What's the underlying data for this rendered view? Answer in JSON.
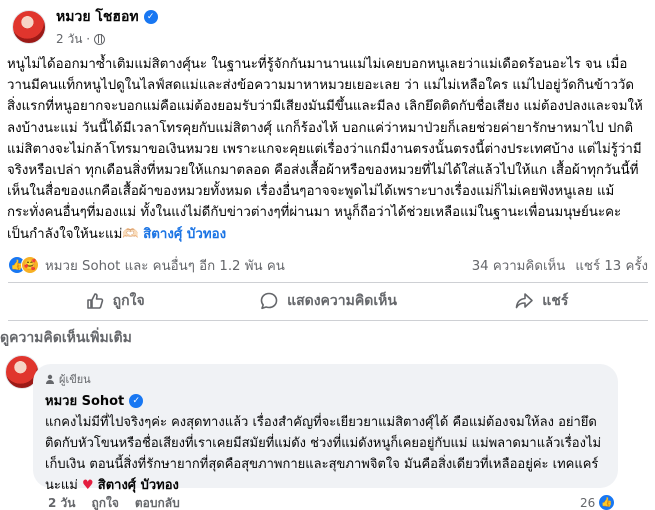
{
  "post": {
    "author": "หมวย โชฮอท",
    "time": "2 วัน ·",
    "body": "หนูไม่ได้ออกมาซ้ำเติมแม่สิตางศุ์นะ ในฐานะที่รู้จักกันมานานแม่ไม่เคยบอกหนูเลยว่าแม่เดือดร้อนอะไร จน เมื่อวานมีคนแท็กหนูไปดูในไลฟ์สดแม่และส่งข้อความมาหาหมวยเยอะเลย ว่า แม่ไม่เหลือใคร แม่ไปอยู่วัดกินข้าววัด สิ่งแรกที่หนูอยากจะบอกแม่คือแม่ต้องยอมรับว่ามีเสียงมันมีขึ้นและมีลง เลิกยึดติดกับชื่อเสียง แม่ต้องปลงและจมให้ลงบ้างนะแม่ วันนี้ได้มีเวลาโทรคุยกับแม่สิตางศุ์ แกก็ร้องไห้ บอกแค่ว่าหมาป่วยก็เลยช่วยค่ายารักษาหมาไป ปกติแม่สิตางจะไม่กล้าโทรมาขอเงินหมวย เพราะแกจะคุยแต่เรื่องว่าแกมีงานตรงนั้นตรงนี้ต่างประเทศบ้าง แต่ไม่รู้ว่ามีจริงหรือเปล่า ทุกเดือนสิ่งที่หมวยให้แกมาตลอด คือส่งเสื้อผ้าหรือของหมวยที่ไม่ได้ใส่แล้วไปให้แก เสื้อผ้าทุกวันนี้ที่เห็นในสื่อของแกคือเสื้อผ้าของหมวยทั้งหมด เรื่องอื่นๆอาจจะพูดไม่ได้เพราะบางเรื่องแม่ก็ไม่เคยฟังหนูเลย แม้กระทั่งคนอื่นๆที่มองแม่ ทั้งในแง่ไม่ดีกับข่าวต่างๆที่ผ่านมา หนูก็ถือว่าได้ช่วยเหลือแม่ในฐานะเพื่อนมนุษย์นะคะ เป็นกำลังใจให้นะแม่🫶🏻",
    "mention": "สิตางศุ์ บัวทอง"
  },
  "reactions": {
    "names": "หมวย Sohot และ คนอื่นๆ อีก 1.2 พัน คน",
    "comments_count": "34 ความคิดเห็น",
    "shares_count": "แชร์ 13 ครั้ง"
  },
  "actions": {
    "like": "ถูกใจ",
    "comment": "แสดงความคิดเห็น",
    "share": "แชร์"
  },
  "more_comments": "ดูความคิดเห็นเพิ่มเติม",
  "comment": {
    "badge": "ผู้เขียน",
    "author": "หมวย Sohot",
    "text": "แกคงไม่มีที่ไปจริงๆค่ะ คงสุดทางแล้ว เรื่องสำคัญที่จะเยียวยาแม่สิตางศุ์ได้ คือแม่ต้องจมให้ลง อย่ายึดติดกับหัวโขนหรือชื่อเสียงที่เราเคยมีสมัยที่แม่ดัง ช่วงที่แม่ดังหนูก็เคยอยู่กับแม่ แม่พลาดมาแล้วเรื่องไม่เก็บเงิน ตอนนี้สิ่งที่รักษายากที่สุดคือสุขภาพกายและสุขภาพจิตใจ มันคือสิ่งเดียวที่เหลืออยู่ค่ะ เทคแคร์นะแม่",
    "mention": "สิตางศุ์ บัวทอง",
    "time": "2 วัน",
    "like": "ถูกใจ",
    "reply": "ตอบกลับ",
    "reaction_count": "26"
  },
  "colors": {
    "accent": "#1877f2",
    "heart": "#e41e3f"
  }
}
